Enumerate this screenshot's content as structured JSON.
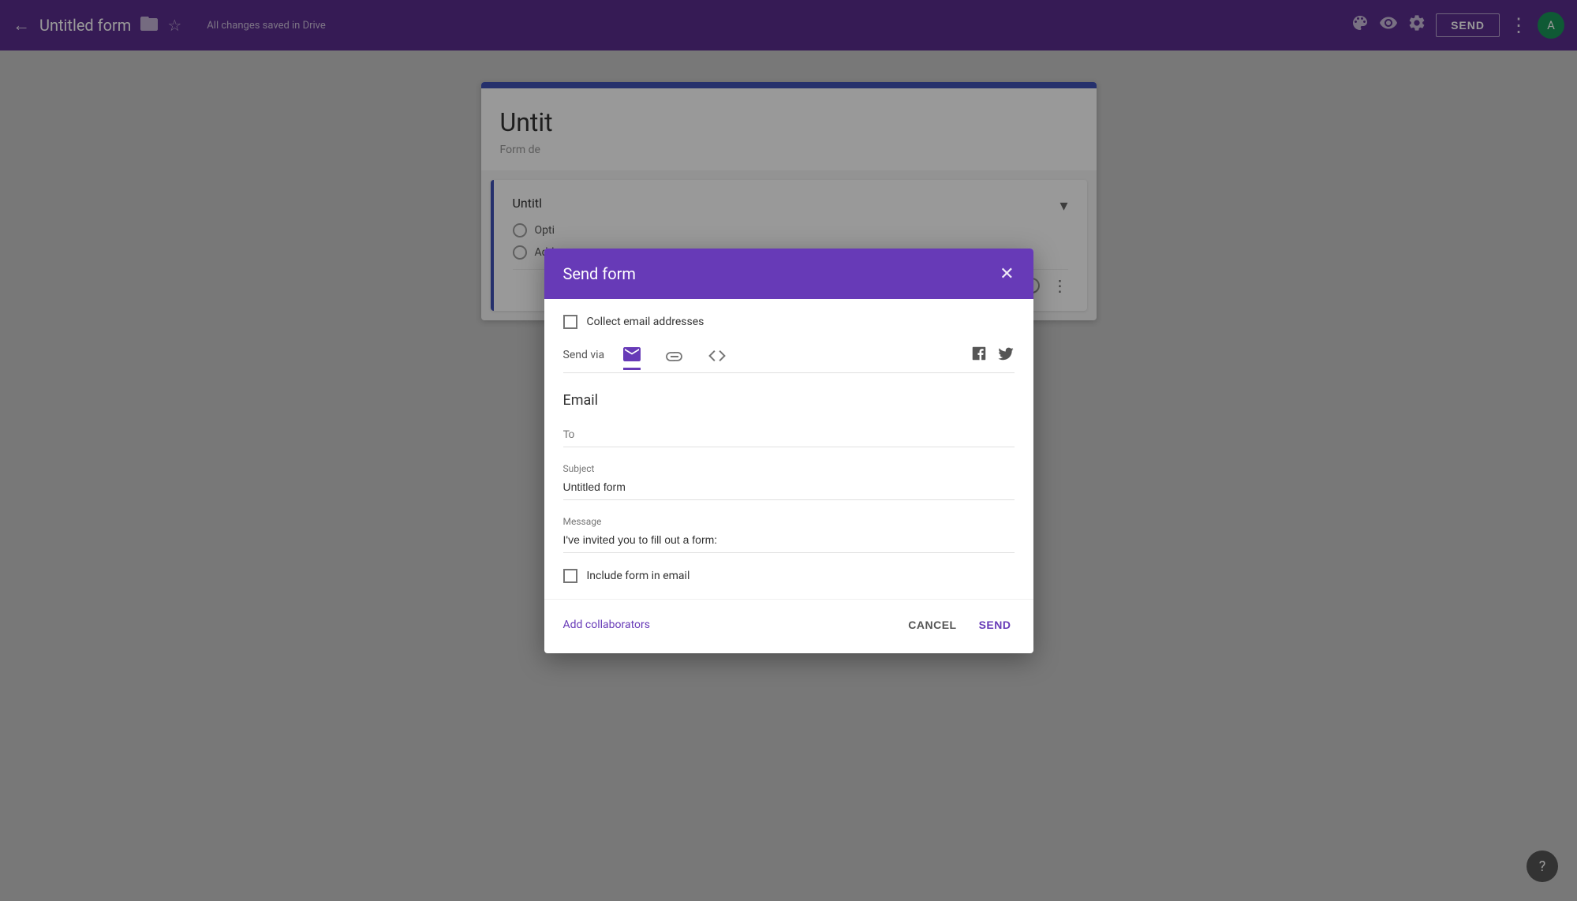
{
  "topbar": {
    "back_icon": "←",
    "title": "Untitled form",
    "folder_icon": "📁",
    "star_icon": "☆",
    "saved_text": "All changes saved in Drive",
    "palette_icon": "🎨",
    "eye_icon": "👁",
    "settings_icon": "⚙",
    "send_label": "SEND",
    "more_icon": "⋮",
    "avatar_letter": "A"
  },
  "background": {
    "form_title": "Untit",
    "form_desc": "Form de",
    "question_title": "Untitl",
    "option1": "Opti",
    "option2": "Add"
  },
  "dialog": {
    "title": "Send form",
    "close_icon": "✕",
    "collect_email_label": "Collect email addresses",
    "send_via_label": "Send via",
    "email_tab_active": true,
    "email_section_title": "Email",
    "to_label": "To",
    "to_value": "",
    "subject_label": "Subject",
    "subject_value": "Untitled form",
    "message_label": "Message",
    "message_value": "I've invited you to fill out a form:",
    "include_form_label": "Include form in email",
    "add_collaborators_label": "Add collaborators",
    "cancel_label": "CANCEL",
    "send_label": "SEND"
  },
  "help": {
    "icon": "?"
  }
}
